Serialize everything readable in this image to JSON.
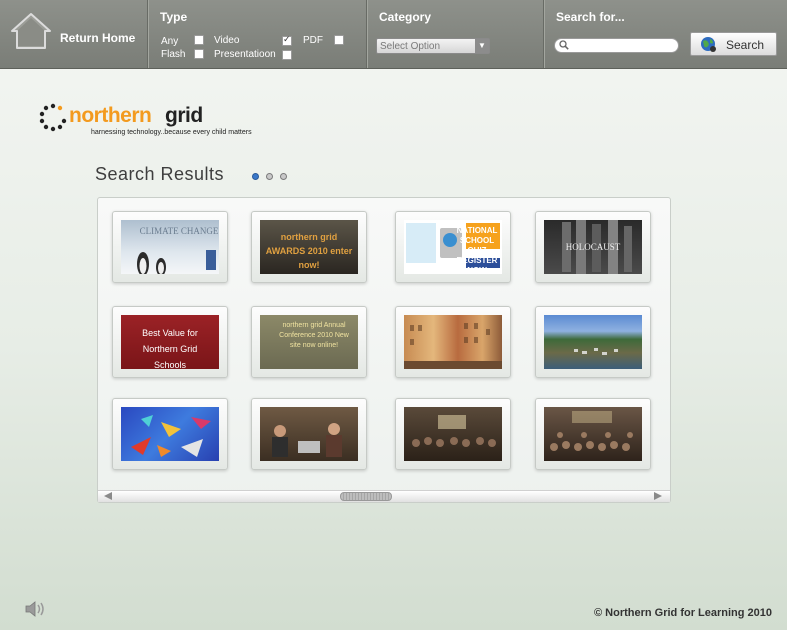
{
  "nav": {
    "return_home_label": "Return Home",
    "home_icon": "home-icon"
  },
  "filters": {
    "type_title": "Type",
    "options": [
      {
        "label": "Any",
        "checked": false
      },
      {
        "label": "Video",
        "checked": true
      },
      {
        "label": "PDF",
        "checked": false
      },
      {
        "label": "Flash",
        "checked": false
      },
      {
        "label": "Presentatioon",
        "checked": false
      }
    ],
    "category_title": "Category",
    "category_selected": "Select Option"
  },
  "search": {
    "title": "Search for...",
    "value": "",
    "button_label": "Search"
  },
  "brand": {
    "logo_part1": "northern",
    "logo_part2": "grid",
    "tagline": "harnessing technology..because every child matters",
    "logo_orange": "#f39a1e"
  },
  "results": {
    "title": "Search Results",
    "pages": 3,
    "active_page": 1,
    "items": [
      {
        "caption": "CLIMATE CHANGE"
      },
      {
        "caption": "northern grid AWARDS 2010 enter now!"
      },
      {
        "caption": "NATIONAL SCHOOL QUIZ REGISTER NOW"
      },
      {
        "caption": "HOLOCAUST"
      },
      {
        "caption": "Best Value for Northern Grid Schools"
      },
      {
        "caption": "northern grid Annual Conference 2010 New site now online!"
      },
      {
        "caption": ""
      },
      {
        "caption": ""
      },
      {
        "caption": ""
      },
      {
        "caption": ""
      },
      {
        "caption": ""
      },
      {
        "caption": ""
      }
    ]
  },
  "footer": {
    "copyright": "© Northern Grid for Learning 2010"
  }
}
